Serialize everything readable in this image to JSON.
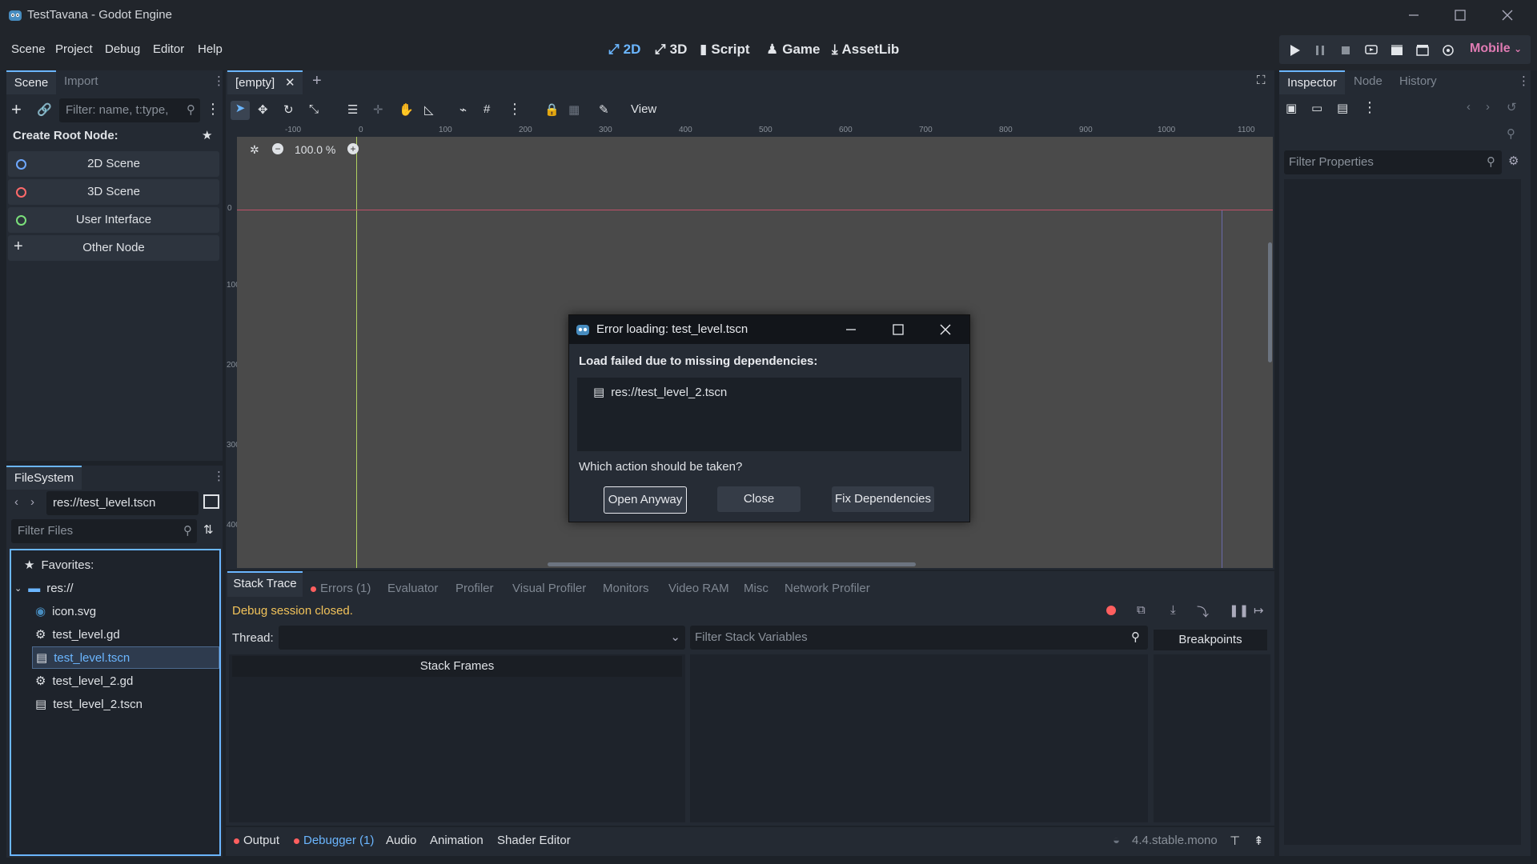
{
  "window": {
    "title": "TestTavana - Godot Engine"
  },
  "menu": {
    "items": [
      "Scene",
      "Project",
      "Debug",
      "Editor",
      "Help"
    ]
  },
  "workspaces": {
    "tabs": [
      "2D",
      "3D",
      "Script",
      "Game",
      "AssetLib"
    ],
    "active": "2D"
  },
  "renderer": "Mobile",
  "scene_dock": {
    "tabs": [
      "Scene",
      "Import"
    ],
    "filter_placeholder": "Filter: name, t:type,",
    "create_root_label": "Create Root Node:",
    "root_options": [
      {
        "label": "2D Scene",
        "color": "#6ea8ff"
      },
      {
        "label": "3D Scene",
        "color": "#ff6a6a"
      },
      {
        "label": "User Interface",
        "color": "#7be07b"
      },
      {
        "label": "Other Node",
        "color": "#dfe2e6"
      }
    ]
  },
  "filesystem": {
    "tab": "FileSystem",
    "path": "res://test_level.tscn",
    "filter_placeholder": "Filter Files",
    "items": [
      {
        "label": "Favorites:",
        "icon": "star-icon"
      },
      {
        "label": "res://",
        "icon": "folder-icon"
      },
      {
        "label": "icon.svg",
        "icon": "image-icon"
      },
      {
        "label": "test_level.gd",
        "icon": "gear-icon"
      },
      {
        "label": "test_level.tscn",
        "icon": "clapper-icon",
        "selected": true
      },
      {
        "label": "test_level_2.gd",
        "icon": "gear-icon"
      },
      {
        "label": "test_level_2.tscn",
        "icon": "clapper-icon"
      }
    ]
  },
  "editor": {
    "scene_tab": "[empty]",
    "view_menu": "View",
    "zoom": "100.0 %",
    "ruler_h": [
      "-100",
      "0",
      "100",
      "200",
      "300",
      "400",
      "500",
      "600",
      "700",
      "800",
      "900",
      "1000",
      "1100"
    ],
    "ruler_v": [
      "0",
      "100",
      "200",
      "300",
      "400"
    ]
  },
  "dialog": {
    "title": "Error loading: test_level.tscn",
    "message": "Load failed due to missing dependencies:",
    "dependency": "res://test_level_2.tscn",
    "question": "Which action should be taken?",
    "buttons": [
      "Open Anyway",
      "Close",
      "Fix Dependencies"
    ]
  },
  "inspector": {
    "tabs": [
      "Inspector",
      "Node",
      "History"
    ],
    "filter_placeholder": "Filter Properties"
  },
  "debugger": {
    "tabs": [
      "Stack Trace",
      "Errors (1)",
      "Evaluator",
      "Profiler",
      "Visual Profiler",
      "Monitors",
      "Video RAM",
      "Misc",
      "Network Profiler"
    ],
    "status": "Debug session closed.",
    "thread_label": "Thread:",
    "filter_vars_placeholder": "Filter Stack Variables",
    "stack_frames": "Stack Frames",
    "breakpoints": "Breakpoints"
  },
  "bottom_panel": {
    "tabs": [
      "Output",
      "Debugger (1)",
      "Audio",
      "Animation",
      "Shader Editor"
    ],
    "version": "4.4.stable.mono"
  },
  "colors": {
    "accent": "#6bb6ff",
    "error": "#ff5f5f",
    "warning_text": "#f2c35a"
  }
}
